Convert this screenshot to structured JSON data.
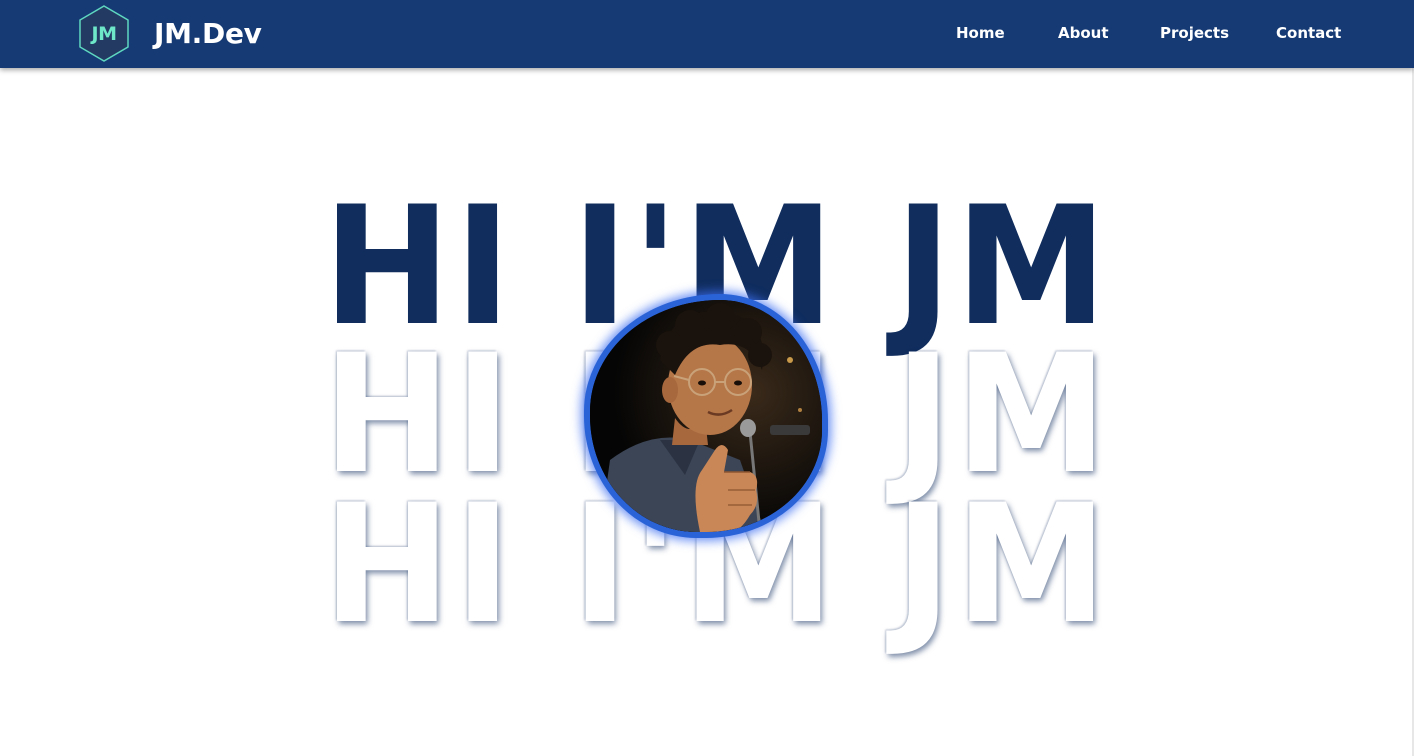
{
  "nav": {
    "logo_badge": "JM",
    "brand": "JM.Dev",
    "links": [
      "Home",
      "About",
      "Projects",
      "Contact"
    ]
  },
  "hero": {
    "lines": [
      "HI I'M JM",
      "HI I'M JM",
      "HI I'M JM"
    ]
  },
  "colors": {
    "navbar": "#163a74",
    "logo_accent": "#6ee7c8",
    "hero_dark": "#102d5e",
    "avatar_ring": "#2a63d8"
  },
  "icons": {
    "logo": "hexagon-logo-icon",
    "avatar": "profile-photo"
  }
}
